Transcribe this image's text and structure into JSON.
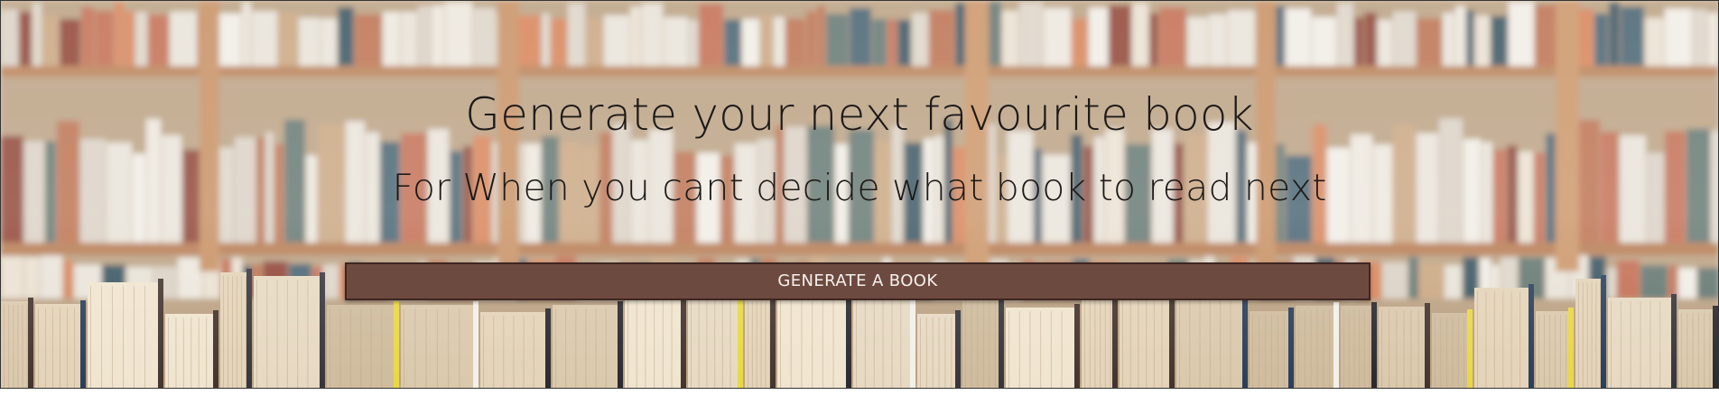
{
  "hero": {
    "background": "bookshelf-photo",
    "title": "Generate your next favourite book",
    "subtitle": "For When you cant decide what book to read next",
    "button_label": "GENERATE A BOOK",
    "button_color": "#6d4a40",
    "text_color": "#1d1a18"
  }
}
